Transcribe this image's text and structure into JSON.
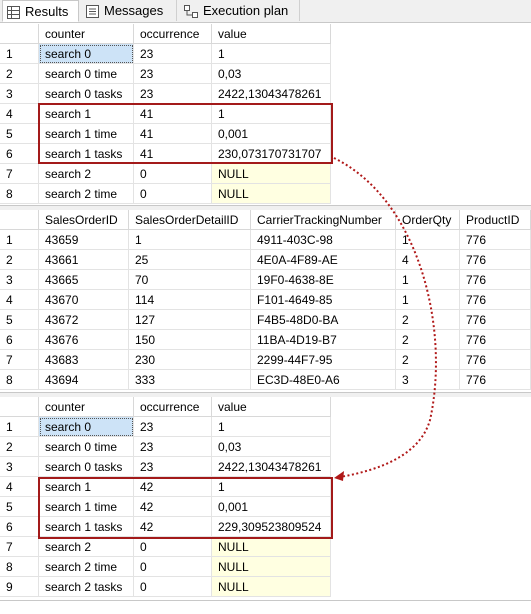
{
  "tabs": [
    {
      "label": "Results",
      "icon": "grid-icon",
      "active": true
    },
    {
      "label": "Messages",
      "icon": "messages-icon",
      "active": false
    },
    {
      "label": "Execution plan",
      "icon": "execution-plan-icon",
      "active": false
    }
  ],
  "grid1": {
    "columns": [
      "counter",
      "occurrence",
      "value"
    ],
    "rows": [
      {
        "n": "1",
        "c": [
          "search 0",
          "23",
          "1"
        ]
      },
      {
        "n": "2",
        "c": [
          "search 0 time",
          "23",
          "0,03"
        ]
      },
      {
        "n": "3",
        "c": [
          "search 0 tasks",
          "23",
          "2422,13043478261"
        ]
      },
      {
        "n": "4",
        "c": [
          "search 1",
          "41",
          "1"
        ]
      },
      {
        "n": "5",
        "c": [
          "search 1 time",
          "41",
          "0,001"
        ]
      },
      {
        "n": "6",
        "c": [
          "search 1 tasks",
          "41",
          "230,073170731707"
        ]
      },
      {
        "n": "7",
        "c": [
          "search 2",
          "0",
          "NULL"
        ]
      },
      {
        "n": "8",
        "c": [
          "search 2 time",
          "0",
          "NULL"
        ]
      }
    ]
  },
  "grid2": {
    "columns": [
      "SalesOrderID",
      "SalesOrderDetailID",
      "CarrierTrackingNumber",
      "OrderQty",
      "ProductID"
    ],
    "rows": [
      {
        "n": "1",
        "c": [
          "43659",
          "1",
          "4911-403C-98",
          "1",
          "776"
        ]
      },
      {
        "n": "2",
        "c": [
          "43661",
          "25",
          "4E0A-4F89-AE",
          "4",
          "776"
        ]
      },
      {
        "n": "3",
        "c": [
          "43665",
          "70",
          "19F0-4638-8E",
          "1",
          "776"
        ]
      },
      {
        "n": "4",
        "c": [
          "43670",
          "114",
          "F101-4649-85",
          "1",
          "776"
        ]
      },
      {
        "n": "5",
        "c": [
          "43672",
          "127",
          "F4B5-48D0-BA",
          "2",
          "776"
        ]
      },
      {
        "n": "6",
        "c": [
          "43676",
          "150",
          "11BA-4D19-B7",
          "2",
          "776"
        ]
      },
      {
        "n": "7",
        "c": [
          "43683",
          "230",
          "2299-44F7-95",
          "2",
          "776"
        ]
      },
      {
        "n": "8",
        "c": [
          "43694",
          "333",
          "EC3D-48E0-A6",
          "3",
          "776"
        ]
      }
    ]
  },
  "grid3": {
    "columns": [
      "counter",
      "occurrence",
      "value"
    ],
    "rows": [
      {
        "n": "1",
        "c": [
          "search 0",
          "23",
          "1"
        ]
      },
      {
        "n": "2",
        "c": [
          "search 0 time",
          "23",
          "0,03"
        ]
      },
      {
        "n": "3",
        "c": [
          "search 0 tasks",
          "23",
          "2422,13043478261"
        ]
      },
      {
        "n": "4",
        "c": [
          "search 1",
          "42",
          "1"
        ]
      },
      {
        "n": "5",
        "c": [
          "search 1 time",
          "42",
          "0,001"
        ]
      },
      {
        "n": "6",
        "c": [
          "search 1 tasks",
          "42",
          "229,309523809524"
        ]
      },
      {
        "n": "7",
        "c": [
          "search 2",
          "0",
          "NULL"
        ]
      },
      {
        "n": "8",
        "c": [
          "search 2 time",
          "0",
          "NULL"
        ]
      },
      {
        "n": "9",
        "c": [
          "search 2 tasks",
          "0",
          "NULL"
        ]
      }
    ]
  },
  "colors": {
    "highlight": "#a31a1a",
    "null_bg": "#ffffe1",
    "selected": "#cde3f7"
  }
}
